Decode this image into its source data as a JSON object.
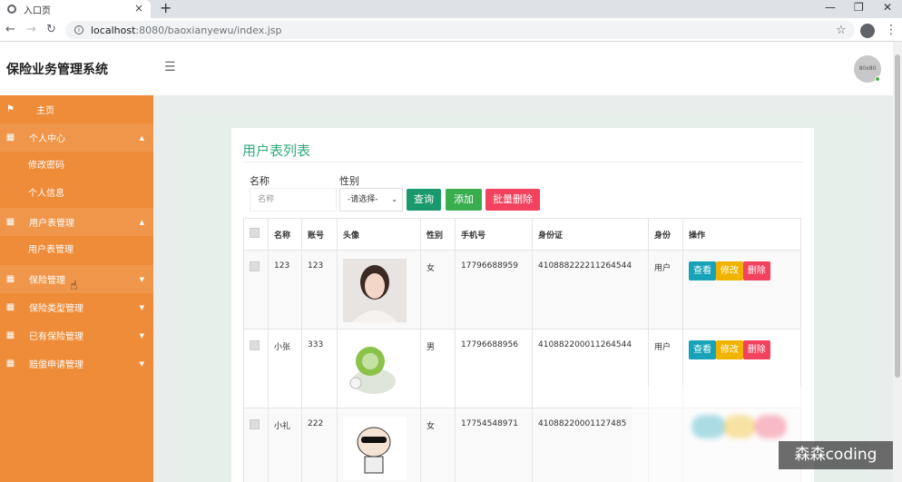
{
  "browser": {
    "tab_title": "入口页",
    "url_host": "localhost",
    "url_rest": ":8080/baoxianyewu/index.jsp"
  },
  "app": {
    "brand": "保险业务管理系统",
    "avatar_text": "80x80"
  },
  "sidebar": {
    "home": "主页",
    "personal_center": "个人中心",
    "change_password": "修改密码",
    "personal_info": "个人信息",
    "user_table_mgmt": "用户表管理",
    "user_table_mgmt_sub": "用户表管理",
    "insurance_mgmt": "保险管理",
    "insurance_type_mgmt": "保险类型管理",
    "owned_insurance_mgmt": "已有保险管理",
    "claim_request_mgmt": "赔偿申请管理"
  },
  "page": {
    "title": "用户表列表",
    "name_label": "名称",
    "name_placeholder": "名称",
    "gender_label": "性别",
    "gender_select": "-请选择-",
    "query_button": "查询",
    "add_button": "添加",
    "batch_delete_button": "批量删除"
  },
  "table": {
    "headers": [
      "名称",
      "账号",
      "头像",
      "性别",
      "手机号",
      "身份证",
      "身份",
      "操作"
    ],
    "rows": [
      {
        "name": "123",
        "account": "123",
        "gender": "女",
        "phone": "17796688959",
        "id_card": "410888222211264544",
        "role": "用户"
      },
      {
        "name": "小张",
        "account": "333",
        "gender": "男",
        "phone": "17796688956",
        "id_card": "410882200011264544",
        "role": "用户"
      },
      {
        "name": "小礼",
        "account": "222",
        "gender": "女",
        "phone": "17754548971",
        "id_card": "41088220001127485",
        "role": ""
      }
    ],
    "action_view": "查看",
    "action_edit": "修改",
    "action_delete": "删除"
  },
  "colors": {
    "sidebar_bg": "#ef8c39",
    "title_green": "#2faa7a",
    "btn_query": "#1a9a6c",
    "btn_add": "#3aad4e",
    "btn_delete": "#f2425d",
    "btn_view": "#17a2b8",
    "btn_edit": "#f0b400"
  },
  "watermark": "森森coding"
}
